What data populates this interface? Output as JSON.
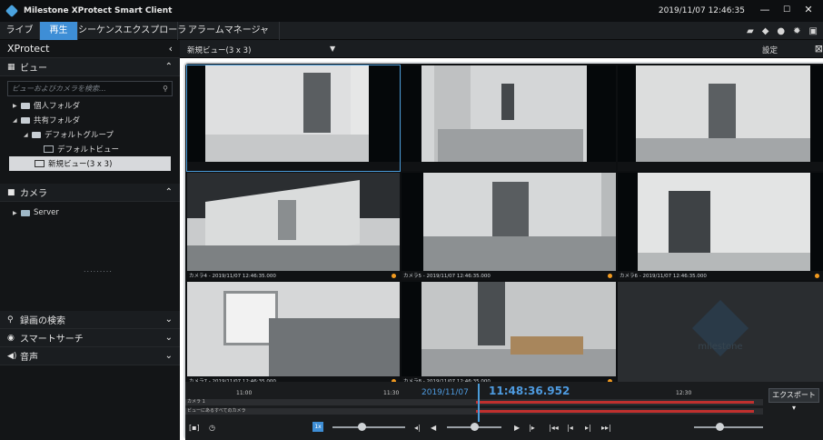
{
  "titlebar": {
    "app_title": "Milestone XProtect Smart Client",
    "datetime": "2019/11/07 12:46:35",
    "minimize": "—",
    "maximize": "☐",
    "close": "✕"
  },
  "tabs": [
    "ライブ",
    "再生",
    "シーケンスエクスプローラ",
    "アラームマネージャ"
  ],
  "active_tab": "再生",
  "sidebar": {
    "product": "XProtect",
    "views_section": "ビュー",
    "search_placeholder": "ビューおよびカメラを検索...",
    "tree": [
      {
        "label": "個人フォルダ"
      },
      {
        "label": "共有フォルダ"
      },
      {
        "label": "デフォルトグループ"
      },
      {
        "label": "デフォルトビュー"
      },
      {
        "label": "新規ビュー(3 x 3)"
      }
    ],
    "cameras_section": "カメラ",
    "server": "Server",
    "bottom_sections": [
      "録画の検索",
      "スマートサーチ",
      "音声"
    ]
  },
  "main": {
    "view_name": "新規ビュー(3 x 3)",
    "settings": "設定"
  },
  "cameras": [
    {
      "caption": "",
      "dot": false
    },
    {
      "caption": "",
      "dot": false
    },
    {
      "caption": "",
      "dot": false
    },
    {
      "caption": "カメラ4 - 2019/11/07 12:46:35.000",
      "dot": true
    },
    {
      "caption": "カメラ5 - 2019/11/07 12:46:35.000",
      "dot": true
    },
    {
      "caption": "カメラ6 - 2019/11/07 12:46:35.000",
      "dot": true
    },
    {
      "caption": "カメラ7 - 2019/11/07 12:46:35.000",
      "dot": true
    },
    {
      "caption": "カメラ8 - 2019/11/07 12:46:35.000",
      "dot": true
    },
    {
      "caption": "",
      "dot": false
    }
  ],
  "empty_cell_logo": "milestone",
  "timeline": {
    "ticks": [
      "11:00",
      "11:30",
      "12:30"
    ],
    "date": "2019/11/07",
    "time": "11:48:36.952",
    "rows": [
      "カメラ 1",
      "ビューにあるすべてのカメラ"
    ],
    "export": "エクスポート ▾",
    "speed": "1x"
  },
  "colors": {
    "accent": "#3e8ed6",
    "recording": "#c0302e",
    "event_dot": "#f29a1f"
  }
}
